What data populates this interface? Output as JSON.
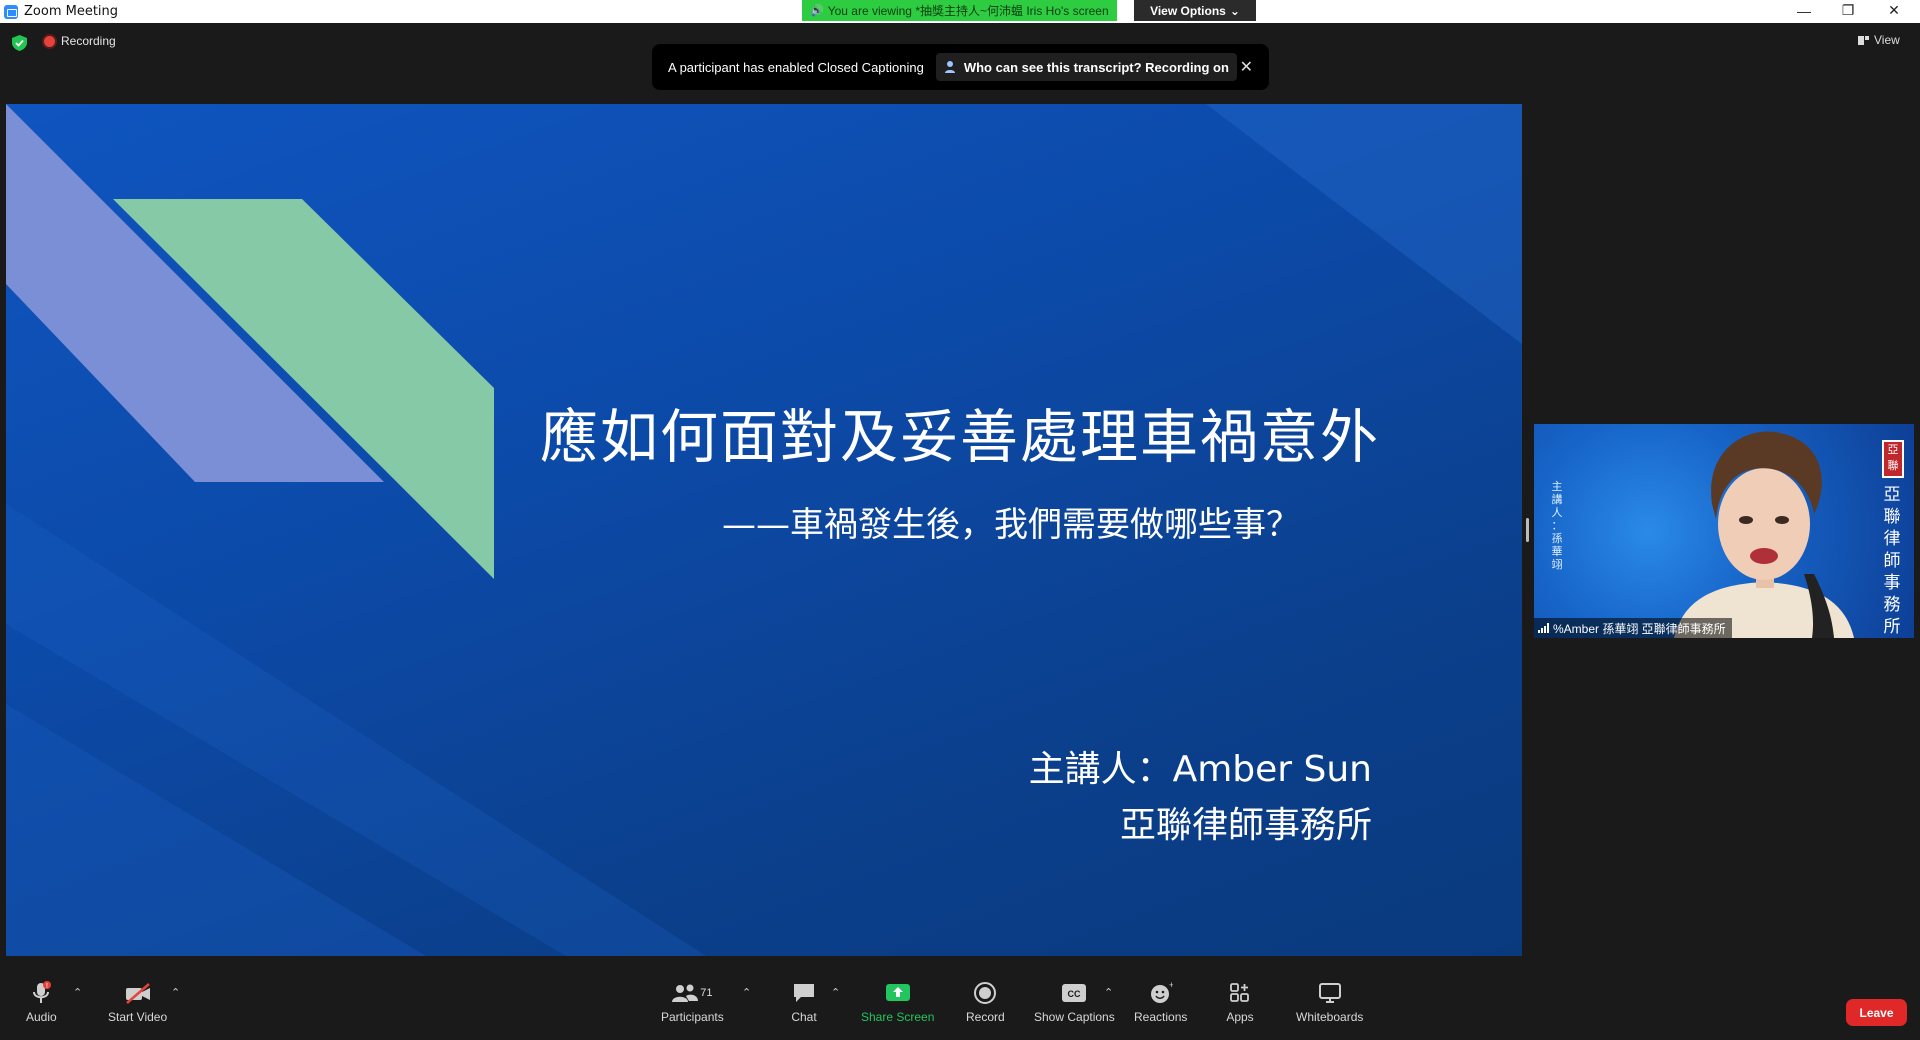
{
  "window": {
    "title": "Zoom Meeting",
    "viewing_banner": "You are viewing *抽獎主持人~何沛蝹 Iris Ho's screen",
    "view_options_label": "View Options"
  },
  "status": {
    "recording_label": "Recording",
    "view_label": "View"
  },
  "caption_toast": {
    "message": "A participant has enabled Closed Captioning",
    "question": "Who can see this transcript? Recording on"
  },
  "slide": {
    "title": "應如何面對及妥善處理車禍意外",
    "subtitle": "——車禍發生後，我們需要做哪些事？",
    "presenter": "主講人：Amber Sun",
    "firm": "亞聯律師事務所"
  },
  "video": {
    "name_tag": "%Amber 孫華翊 亞聯律師事務所",
    "side_left_text": "主講人：孫華翊",
    "side_right_text": "亞聯律師事務所",
    "seal_text": "亞聯"
  },
  "toolbar": {
    "audio": "Audio",
    "start_video": "Start Video",
    "participants": "Participants",
    "participants_count": "71",
    "chat": "Chat",
    "share_screen": "Share Screen",
    "record": "Record",
    "show_captions": "Show Captions",
    "reactions": "Reactions",
    "apps": "Apps",
    "whiteboards": "Whiteboards",
    "leave": "Leave"
  },
  "colors": {
    "share_green": "#22c55e",
    "leave_red": "#e02828",
    "banner_green": "#2ecc40",
    "slide_blue": "#0c4aa8",
    "shape_green": "#86c9a6",
    "shape_lavender": "#7b8fd6"
  }
}
